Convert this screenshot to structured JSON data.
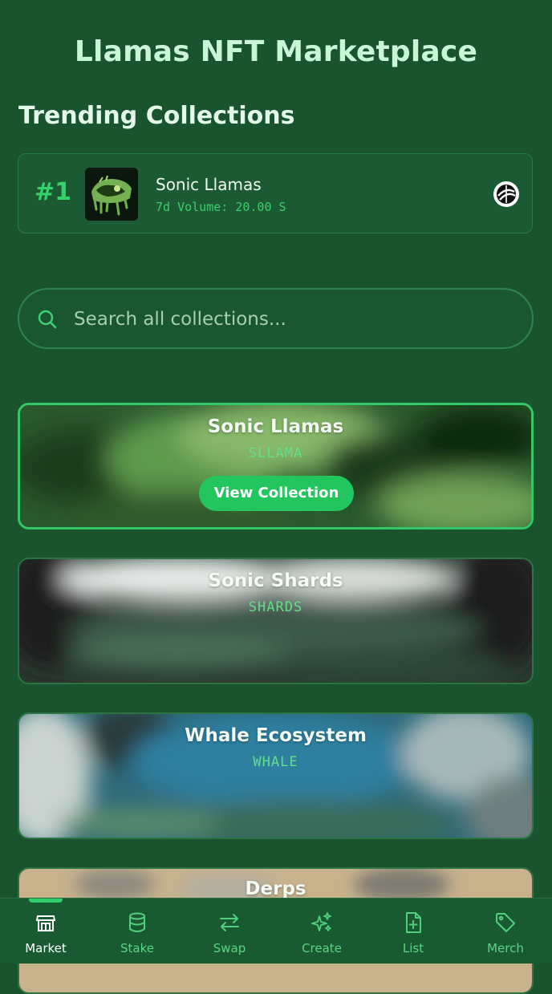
{
  "header": {
    "title": "Llamas NFT Marketplace"
  },
  "trending": {
    "section_title": "Trending Collections",
    "items": [
      {
        "rank": "#1",
        "name": "Sonic Llamas",
        "volume": "7d Volume: 20.00 S",
        "chain_icon": "sonic-chain-icon"
      }
    ]
  },
  "search": {
    "placeholder": "Search all collections...",
    "value": ""
  },
  "collections": [
    {
      "name": "Sonic Llamas",
      "symbol": "SLLAMA",
      "button_label": "View Collection",
      "selected": true
    },
    {
      "name": "Sonic Shards",
      "symbol": "SHARDS"
    },
    {
      "name": "Whale Ecosystem",
      "symbol": "WHALE"
    },
    {
      "name": "Derps",
      "symbol": ""
    }
  ],
  "nav": {
    "items": [
      {
        "label": "Market",
        "icon": "storefront-icon",
        "active": true
      },
      {
        "label": "Stake",
        "icon": "database-icon"
      },
      {
        "label": "Swap",
        "icon": "swap-arrows-icon"
      },
      {
        "label": "Create",
        "icon": "sparkles-icon"
      },
      {
        "label": "List",
        "icon": "file-plus-icon"
      },
      {
        "label": "Merch",
        "icon": "tag-icon"
      }
    ]
  },
  "colors": {
    "background": "#19542f",
    "accent": "#22c55e",
    "title": "#c9f6d6"
  }
}
